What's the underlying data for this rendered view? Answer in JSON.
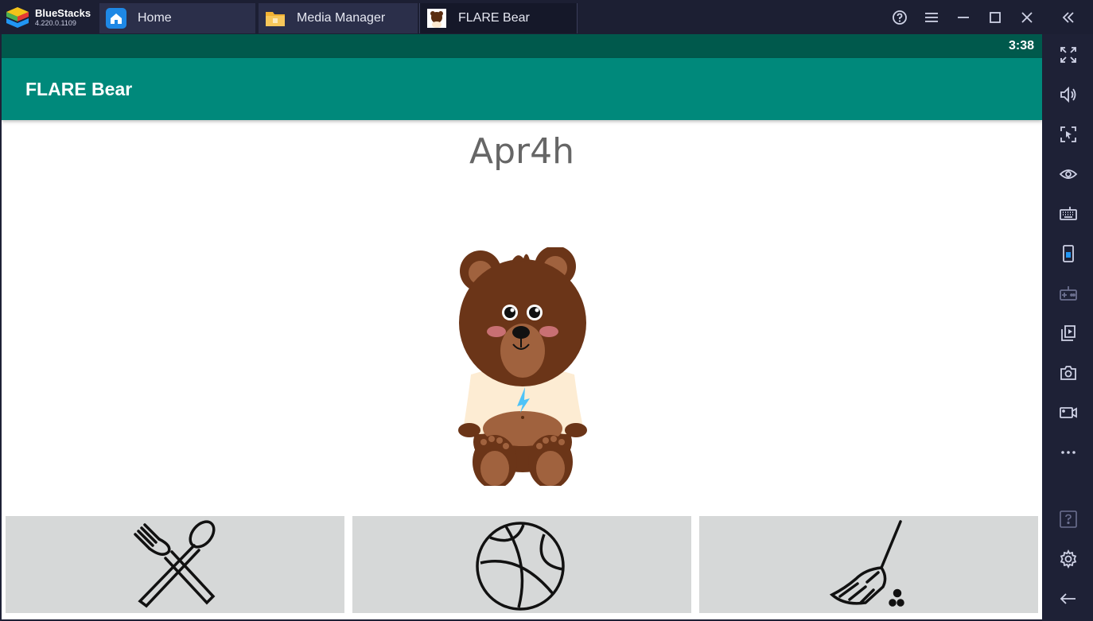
{
  "titlebar": {
    "brand_name": "BlueStacks",
    "brand_version": "4.220.0.1109",
    "tabs": [
      {
        "label": "Home",
        "icon": "home-icon"
      },
      {
        "label": "Media Manager",
        "icon": "folder-icon"
      },
      {
        "label": "FLARE Bear",
        "icon": "bear-app-icon"
      }
    ],
    "controls": [
      "help-icon",
      "menu-icon",
      "minimize-icon",
      "maximize-icon",
      "close-icon",
      "collapse-sidebar-icon"
    ]
  },
  "sidebar": {
    "buttons": [
      "fullscreen-icon",
      "volume-icon",
      "pointer-lock-icon",
      "eye-icon",
      "keyboard-icon",
      "rotate-icon",
      "gamepad-icon",
      "media-import-icon",
      "screenshot-icon",
      "record-icon",
      "more-icon",
      "help-icon",
      "settings-icon",
      "back-icon"
    ]
  },
  "android": {
    "time": "3:38",
    "app_title": "FLARE Bear",
    "bear_name": "Apr4h",
    "actions": [
      {
        "name": "feed-button",
        "icon": "fork-spoon-icon"
      },
      {
        "name": "play-button",
        "icon": "basketball-icon"
      },
      {
        "name": "clean-button",
        "icon": "broom-icon"
      }
    ]
  },
  "colors": {
    "statusbar": "#00594c",
    "appbar": "#00897b",
    "chrome": "#1c1f33",
    "action_bg": "#d6d8d8"
  }
}
